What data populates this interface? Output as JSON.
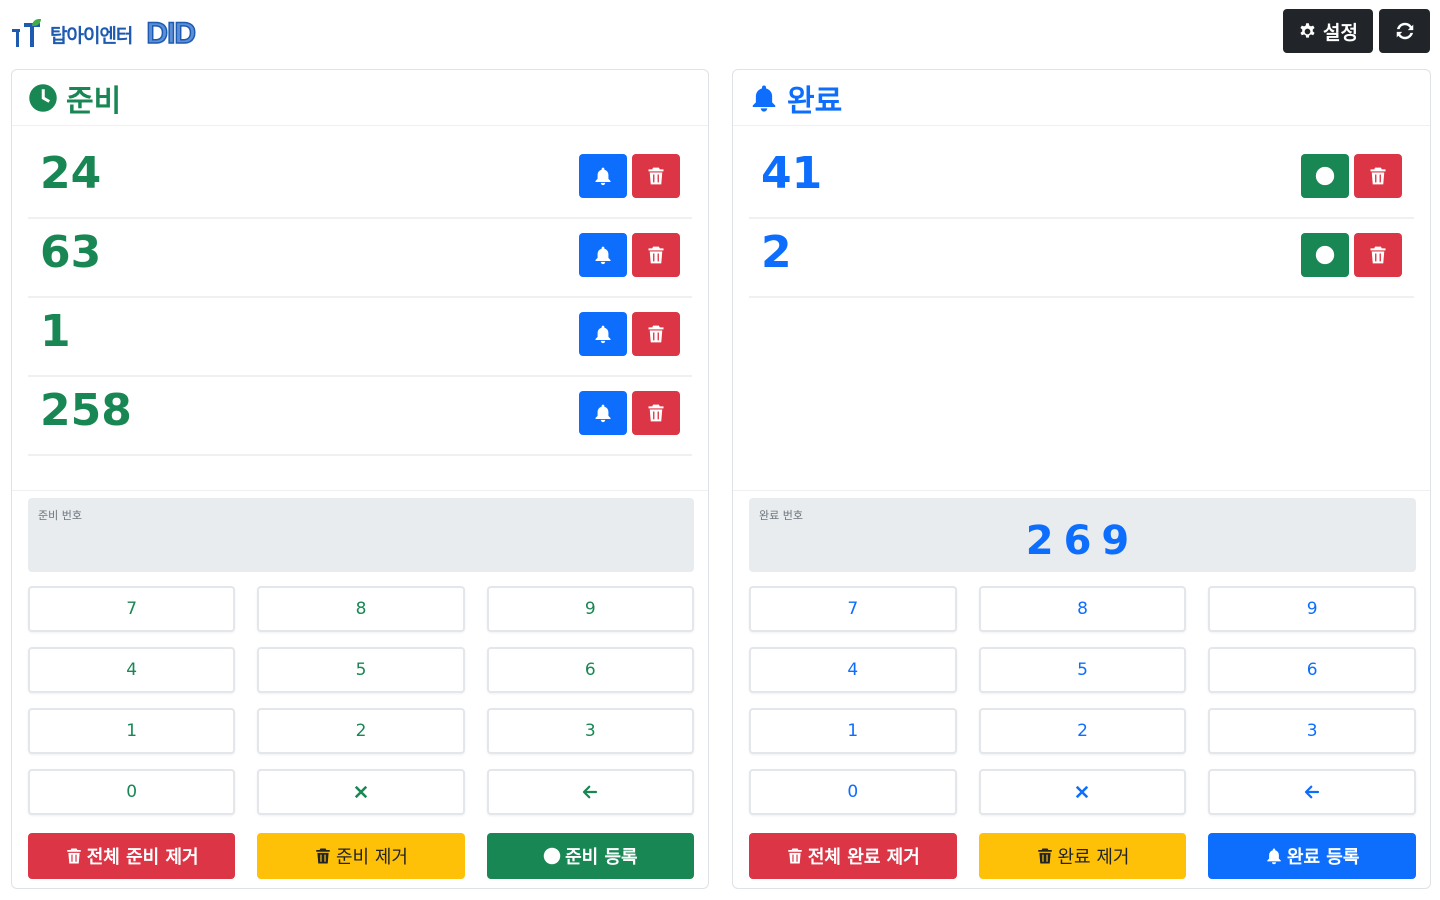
{
  "header": {
    "logo_text": "탑아이엔터",
    "logo_did": "DID",
    "settings_label": "설정"
  },
  "ready": {
    "title": "준비",
    "numbers": [
      "24",
      "63",
      "1",
      "258"
    ],
    "display_label": "준비 번호",
    "display_value": "",
    "keys": [
      "7",
      "8",
      "9",
      "4",
      "5",
      "6",
      "1",
      "2",
      "3",
      "0"
    ],
    "clear_all_label": "전체 준비 제거",
    "remove_label": "준비 제거",
    "register_label": "준비 등록"
  },
  "done": {
    "title": "완료",
    "numbers": [
      "41",
      "2"
    ],
    "display_label": "완료 번호",
    "display_value": "269",
    "keys": [
      "7",
      "8",
      "9",
      "4",
      "5",
      "6",
      "1",
      "2",
      "3",
      "0"
    ],
    "clear_all_label": "전체 완료 제거",
    "remove_label": "완료 제거",
    "register_label": "완료 등록"
  },
  "icons": {
    "ready_header": "clock-icon",
    "done_header": "bell-icon",
    "settings": "gear-icon",
    "refresh": "refresh-icon",
    "to_done": "bell-icon",
    "to_ready": "clock-icon",
    "delete": "trash-icon",
    "clear_key": "x-icon",
    "backspace_key": "arrow-left-icon"
  },
  "colors": {
    "ready_accent": "#198754",
    "done_accent": "#0d6efd",
    "danger": "#dc3545",
    "warning": "#ffc107",
    "dark": "#212529"
  }
}
